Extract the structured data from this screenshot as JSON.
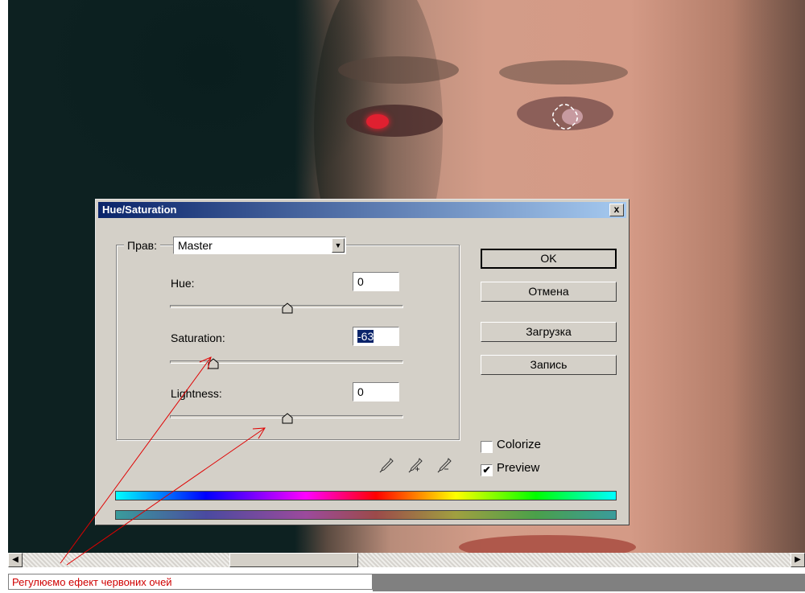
{
  "dialog": {
    "title": "Hue/Saturation",
    "close_label": "x",
    "edit_label": "Прав:",
    "edit_value": "Master",
    "hue_label": "Hue:",
    "hue_value": "0",
    "saturation_label": "Saturation:",
    "saturation_value": "-63",
    "lightness_label": "Lightness:",
    "lightness_value": "0",
    "ok_label": "OK",
    "cancel_label": "Отмена",
    "load_label": "Загрузка",
    "save_label": "Запись",
    "colorize_label": "Colorize",
    "colorize_checked": false,
    "preview_label": "Preview",
    "preview_checked": true
  },
  "statusbar": {
    "text": "Регулюємо ефект червоних очей"
  },
  "colors": {
    "titlebar_start": "#0a246a",
    "titlebar_end": "#a6caf0",
    "annotation": "#e00000"
  }
}
